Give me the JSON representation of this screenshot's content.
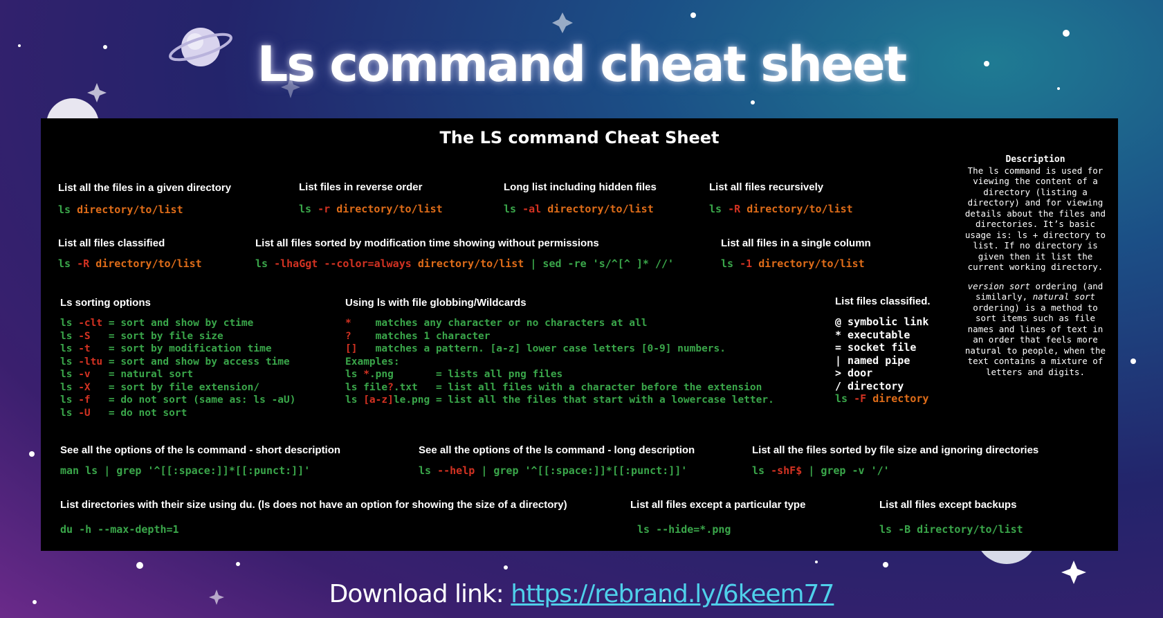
{
  "headline": "Ls command cheat sheet",
  "sheet_title": "The  LS command Cheat Sheet",
  "sec_list_dir": {
    "heading": "List all the files in a given directory",
    "ls": "ls",
    "path": "directory/to/list"
  },
  "sec_reverse": {
    "heading": "List files in reverse order",
    "ls": "ls",
    "flag": "-r",
    "path": "directory/to/list"
  },
  "sec_long": {
    "heading": "Long list including hidden files",
    "ls": "ls",
    "flag": "-al",
    "path": "directory/to/list"
  },
  "sec_recursive": {
    "heading": "List all files recursively",
    "ls": "ls",
    "flag": "-R",
    "path": "directory/to/list"
  },
  "sec_classified_top": {
    "heading": "List all files classified",
    "ls": "ls",
    "flag": "-R",
    "path": "directory/to/list"
  },
  "sec_sorted_mod": {
    "heading": "List all files sorted by modification time showing without permissions",
    "ls": "ls",
    "flag": "-lhaGgt --color=always",
    "path": "directory/to/list",
    "tail": "| sed -re 's/^[^ ]* //'"
  },
  "sec_single_col": {
    "heading": "List all files in a single column",
    "ls": "ls",
    "flag": "-1",
    "path": "directory/to/list"
  },
  "sorting": {
    "heading": "Ls sorting options",
    "items": [
      {
        "ls": "ls",
        "flag": "-clt",
        "pad": " ",
        "desc": "= sort and show by ctime"
      },
      {
        "ls": "ls",
        "flag": "-S",
        "pad": "   ",
        "desc": "= sort by file size"
      },
      {
        "ls": "ls",
        "flag": "-t",
        "pad": "   ",
        "desc": "= sort by modification time"
      },
      {
        "ls": "ls",
        "flag": "-ltu",
        "pad": " ",
        "desc": "= sort and show by access time"
      },
      {
        "ls": "ls",
        "flag": "-v",
        "pad": "   ",
        "desc": "= natural sort"
      },
      {
        "ls": "ls",
        "flag": "-X",
        "pad": "   ",
        "desc": "= sort by file extension/"
      },
      {
        "ls": "ls",
        "flag": "-f",
        "pad": "   ",
        "desc": "= do not sort (same as: ls -aU)"
      },
      {
        "ls": "ls",
        "flag": "-U",
        "pad": "   ",
        "desc": "= do not sort"
      }
    ]
  },
  "globbing": {
    "heading": "Using ls with file globbing/Wildcards",
    "patterns": [
      {
        "sym": "*",
        "pad": "    ",
        "desc": "matches any character or no characters at all"
      },
      {
        "sym": "?",
        "pad": "    ",
        "desc": "matches 1 character"
      },
      {
        "sym": "[]",
        "pad": "   ",
        "desc": "matches a pattern. [a-z] lower case letters [0-9] numbers."
      }
    ],
    "examples_label": "Examples:",
    "examples": [
      {
        "pre": "ls ",
        "hl": "*",
        "post": ".png       = lists all png files"
      },
      {
        "pre": "ls file",
        "hl": "?",
        "post": ".txt   = list all files with a character before the extension"
      },
      {
        "pre": "ls ",
        "hl": "[a-z]",
        "post": "le.png = list all the files that start with a lowercase letter."
      }
    ]
  },
  "classified": {
    "heading": "List files classified.",
    "items": [
      "@ symbolic link",
      "* executable",
      "= socket file",
      "| named pipe",
      "> door",
      "/ directory"
    ],
    "cmd": {
      "ls": "ls",
      "flag": "-F",
      "path": "directory"
    }
  },
  "description": {
    "title": "Description",
    "para1": "The ls command is used for viewing the content of a directory (listing a directory) and for viewing details about the files and directories. It’s basic usage is: ls + directory to list. If no directory is given then it list the current working directory.",
    "para2_em1": "version sort",
    "para2_a": " ordering (and similarly, ",
    "para2_em2": "natural sort",
    "para2_b": " ordering) is a method to sort items such as file names and lines of text in an order that feels more natural to people, when the text contains a mixture of letters and digits."
  },
  "sec_short_opts": {
    "heading": "See all the options of the ls command - short description",
    "cmd": "man ls | grep '^[[:space:]]*[[:punct:]]'"
  },
  "sec_long_opts": {
    "heading": "See all the options of the ls command - long description",
    "ls": "ls",
    "flag": "--help",
    "tail": "| grep '^[[:space:]]*[[:punct:]]'"
  },
  "sec_by_size": {
    "heading": "List all the files sorted by file size and ignoring directories",
    "ls": "ls",
    "flag": "-shF$",
    "tail": "| grep -v '/'"
  },
  "sec_du": {
    "heading": "List directories with their size using du. (ls does not have an option for showing the size of a directory)",
    "cmd": "du -h --max-depth=1"
  },
  "sec_except_type": {
    "heading": "List all files except a particular type",
    "cmd": "ls --hide=*.png"
  },
  "sec_except_backups": {
    "heading": "List all files except backups",
    "cmd": "ls -B directory/to/list"
  },
  "download": {
    "label": "Download link: ",
    "url": "https://rebrand.ly/6keem77"
  }
}
